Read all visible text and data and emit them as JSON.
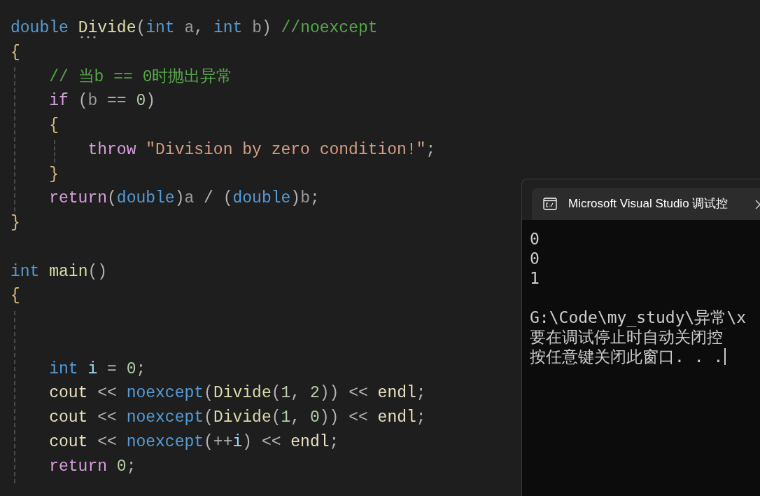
{
  "editor": {
    "lines": [
      {
        "tokens": [
          {
            "text": "double ",
            "kind": "type"
          },
          {
            "text": "Divide",
            "kind": "fn"
          },
          {
            "text": "(",
            "kind": "punct"
          },
          {
            "text": "int ",
            "kind": "type"
          },
          {
            "text": "a",
            "kind": "param"
          },
          {
            "text": ", ",
            "kind": "punct"
          },
          {
            "text": "int ",
            "kind": "type"
          },
          {
            "text": "b",
            "kind": "param"
          },
          {
            "text": ") ",
            "kind": "punct"
          },
          {
            "text": "//noexcept",
            "kind": "comment"
          }
        ]
      },
      {
        "tokens": [
          {
            "text": "{",
            "kind": "brace"
          }
        ]
      },
      {
        "tokens": [
          {
            "text": "    // 当b == 0时抛出异常",
            "kind": "comment"
          }
        ]
      },
      {
        "tokens": [
          {
            "text": "    if ",
            "kind": "control"
          },
          {
            "text": "(",
            "kind": "punct"
          },
          {
            "text": "b",
            "kind": "param"
          },
          {
            "text": " == ",
            "kind": "punct"
          },
          {
            "text": "0",
            "kind": "number"
          },
          {
            "text": ")",
            "kind": "punct"
          }
        ]
      },
      {
        "tokens": [
          {
            "text": "    {",
            "kind": "brace"
          }
        ]
      },
      {
        "tokens": [
          {
            "text": "        throw ",
            "kind": "control"
          },
          {
            "text": "\"Division by zero condition!\"",
            "kind": "string"
          },
          {
            "text": ";",
            "kind": "punct"
          }
        ]
      },
      {
        "tokens": [
          {
            "text": "    }",
            "kind": "brace"
          }
        ]
      },
      {
        "tokens": [
          {
            "text": "    return",
            "kind": "control"
          },
          {
            "text": "(",
            "kind": "punct"
          },
          {
            "text": "double",
            "kind": "type"
          },
          {
            "text": ")",
            "kind": "punct"
          },
          {
            "text": "a",
            "kind": "param"
          },
          {
            "text": " / (",
            "kind": "punct"
          },
          {
            "text": "double",
            "kind": "type"
          },
          {
            "text": ")",
            "kind": "punct"
          },
          {
            "text": "b",
            "kind": "param"
          },
          {
            "text": ";",
            "kind": "punct"
          }
        ]
      },
      {
        "tokens": [
          {
            "text": "}",
            "kind": "brace"
          }
        ]
      },
      {
        "kind": "blank"
      },
      {
        "tokens": [
          {
            "text": "int ",
            "kind": "type"
          },
          {
            "text": "main",
            "kind": "fn"
          },
          {
            "text": "()",
            "kind": "punct"
          }
        ]
      },
      {
        "tokens": [
          {
            "text": "{",
            "kind": "brace"
          }
        ]
      },
      {
        "kind": "blank"
      },
      {
        "kind": "blank"
      },
      {
        "tokens": [
          {
            "text": "    int ",
            "kind": "type"
          },
          {
            "text": "i",
            "kind": "local"
          },
          {
            "text": " = ",
            "kind": "punct"
          },
          {
            "text": "0",
            "kind": "number"
          },
          {
            "text": ";",
            "kind": "punct"
          }
        ]
      },
      {
        "tokens": [
          {
            "text": "    cout",
            "kind": "ident"
          },
          {
            "text": " << ",
            "kind": "punct"
          },
          {
            "text": "noexcept",
            "kind": "type"
          },
          {
            "text": "(",
            "kind": "punct"
          },
          {
            "text": "Divide",
            "kind": "fn"
          },
          {
            "text": "(",
            "kind": "punct"
          },
          {
            "text": "1",
            "kind": "number"
          },
          {
            "text": ", ",
            "kind": "punct"
          },
          {
            "text": "2",
            "kind": "number"
          },
          {
            "text": ")) << ",
            "kind": "punct"
          },
          {
            "text": "endl",
            "kind": "ident"
          },
          {
            "text": ";",
            "kind": "punct"
          }
        ]
      },
      {
        "tokens": [
          {
            "text": "    cout",
            "kind": "ident"
          },
          {
            "text": " << ",
            "kind": "punct"
          },
          {
            "text": "noexcept",
            "kind": "type"
          },
          {
            "text": "(",
            "kind": "punct"
          },
          {
            "text": "Divide",
            "kind": "fn"
          },
          {
            "text": "(",
            "kind": "punct"
          },
          {
            "text": "1",
            "kind": "number"
          },
          {
            "text": ", ",
            "kind": "punct"
          },
          {
            "text": "0",
            "kind": "number"
          },
          {
            "text": ")) << ",
            "kind": "punct"
          },
          {
            "text": "endl",
            "kind": "ident"
          },
          {
            "text": ";",
            "kind": "punct"
          }
        ]
      },
      {
        "tokens": [
          {
            "text": "    cout",
            "kind": "ident"
          },
          {
            "text": " << ",
            "kind": "punct"
          },
          {
            "text": "noexcept",
            "kind": "type"
          },
          {
            "text": "(++",
            "kind": "punct"
          },
          {
            "text": "i",
            "kind": "local"
          },
          {
            "text": ") << ",
            "kind": "punct"
          },
          {
            "text": "endl",
            "kind": "ident"
          },
          {
            "text": ";",
            "kind": "punct"
          }
        ]
      },
      {
        "tokens": [
          {
            "text": "    return ",
            "kind": "control"
          },
          {
            "text": "0",
            "kind": "number"
          },
          {
            "text": ";",
            "kind": "punct"
          }
        ]
      }
    ]
  },
  "console": {
    "tab_title": "Microsoft Visual Studio 调试控",
    "blocks": [
      [
        "0",
        "0",
        "1"
      ],
      [
        "G:\\Code\\my_study\\异常\\x",
        "要在调试停止时自动关闭控",
        "按任意键关闭此窗口. . ."
      ]
    ]
  }
}
